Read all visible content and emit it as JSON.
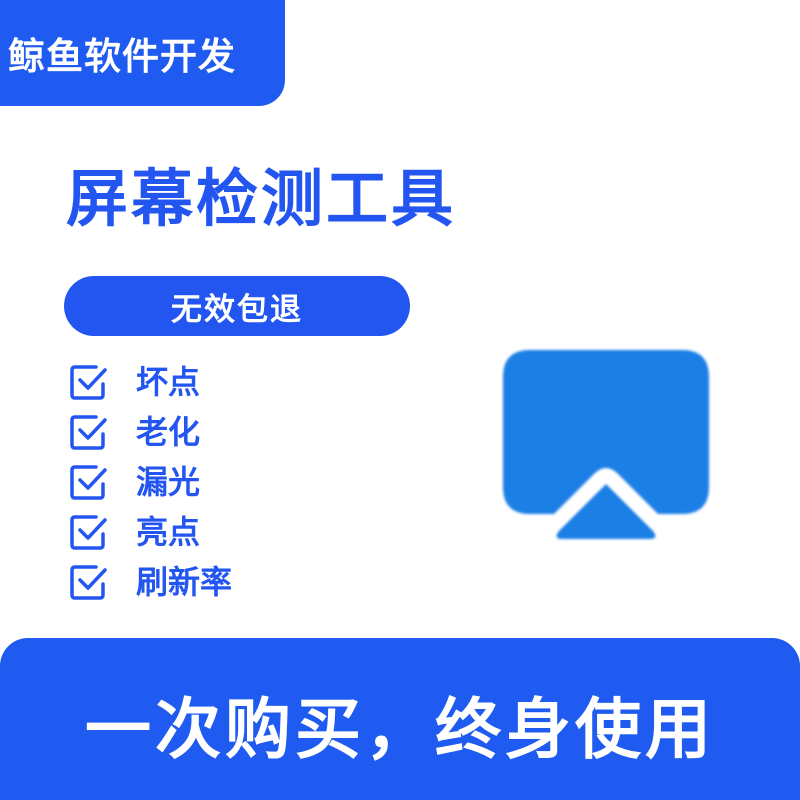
{
  "brand": {
    "name": "鲸鱼软件开发"
  },
  "title": "屏幕检测工具",
  "guarantee": "无效包退",
  "features": [
    {
      "label": "坏点",
      "icon": "checkbox-checked-icon"
    },
    {
      "label": "老化",
      "icon": "checkbox-checked-icon"
    },
    {
      "label": "漏光",
      "icon": "checkbox-checked-icon"
    },
    {
      "label": "亮点",
      "icon": "checkbox-checked-icon"
    },
    {
      "label": "刷新率",
      "icon": "checkbox-checked-icon"
    }
  ],
  "product_icon": "screen-cast-icon",
  "footer": {
    "slogan": "一次购买，终身使用"
  },
  "colors": {
    "primary": "#1f5bf0",
    "text_blue": "#2356f0",
    "icon_blue": "#1f7fe6",
    "white": "#ffffff"
  }
}
